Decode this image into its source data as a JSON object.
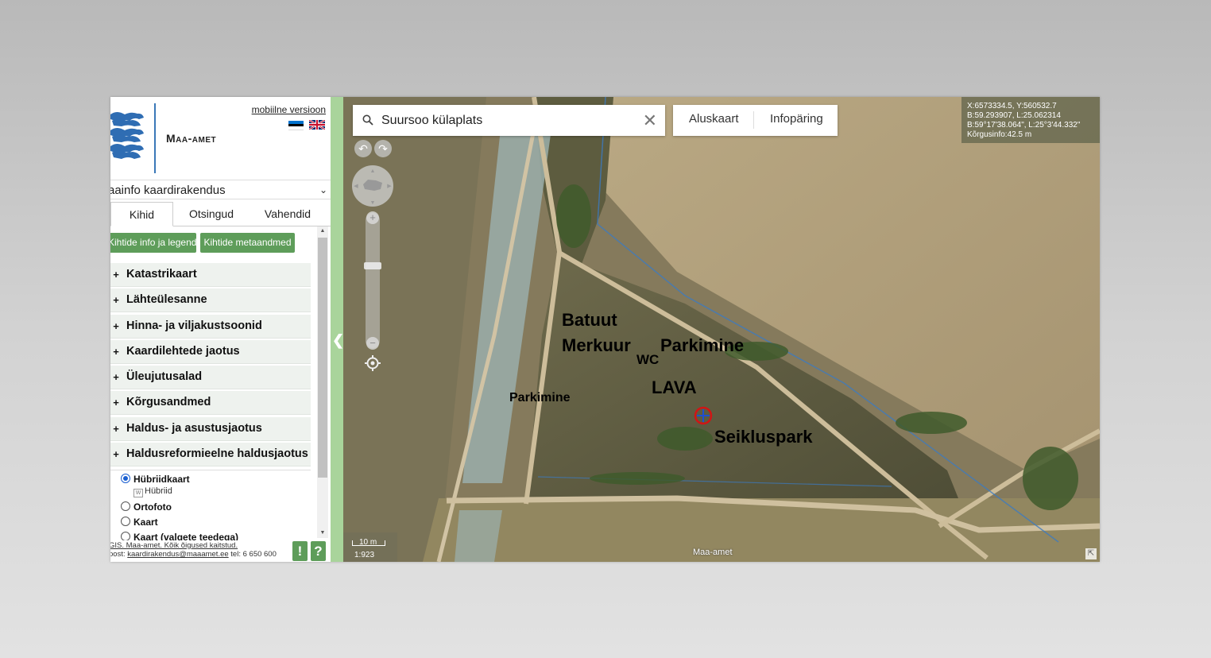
{
  "sidebar": {
    "brand": "Maa-amet",
    "mobile_link": "mobiilne versioon",
    "app_selector": "aainfo kaardirakendus",
    "tabs": [
      {
        "label": "Kihid"
      },
      {
        "label": "Otsingud"
      },
      {
        "label": "Vahendid"
      }
    ],
    "buttons": {
      "legend": "Kihtide info ja legend",
      "metadata": "Kihtide metaandmed"
    },
    "layers": [
      {
        "label": "Katastrikaart"
      },
      {
        "label": "Lähteülesanne"
      },
      {
        "label": "Hinna- ja viljakustsoonid"
      },
      {
        "label": "Kaardilehtede jaotus"
      },
      {
        "label": "Üleujutusalad"
      },
      {
        "label": "Kõrgusandmed"
      },
      {
        "label": "Haldus- ja asustusjaotus"
      },
      {
        "label": "Haldusreformieelne haldusjaotus"
      }
    ],
    "plus_symbol": "+",
    "basemaps": {
      "hybrid": "Hübriidkaart",
      "hybrid_sub": "Hübriid",
      "ortho": "Ortofoto",
      "map": "Kaart",
      "map_white": "Kaart (valgete teedega)"
    },
    "footer": {
      "line1": "GIS. Maa-amet. Kõik õigused kaitstud.",
      "line2_prefix": "post:",
      "email": "kaardirakendus@maaamet.ee",
      "phone": "tel: 6 650 600"
    },
    "info_button": "!",
    "help_button": "?"
  },
  "map": {
    "search": {
      "value": "Suursoo külaplats"
    },
    "buttons": {
      "basemap": "Aluskaart",
      "query": "Infopäring"
    },
    "coords": {
      "xy": "X:6573334.5, Y:560532.7",
      "dec": "B:59.293907, L:25.062314",
      "dms": "B:59°17'38.064\", L:25°3'44.332\"",
      "height": "Kõrgusinfo:42.5 m"
    },
    "labels": {
      "batuut": "Batuut",
      "merkuur": "Merkuur",
      "parkimine1": "Parkimine",
      "wc": "WC",
      "lava": "LAVA",
      "parkimine2": "Parkimine",
      "seikluspark": "Seikluspark"
    },
    "scale": {
      "label": "10 m",
      "ratio": "1:923"
    },
    "attribution": "Maa-amet"
  }
}
